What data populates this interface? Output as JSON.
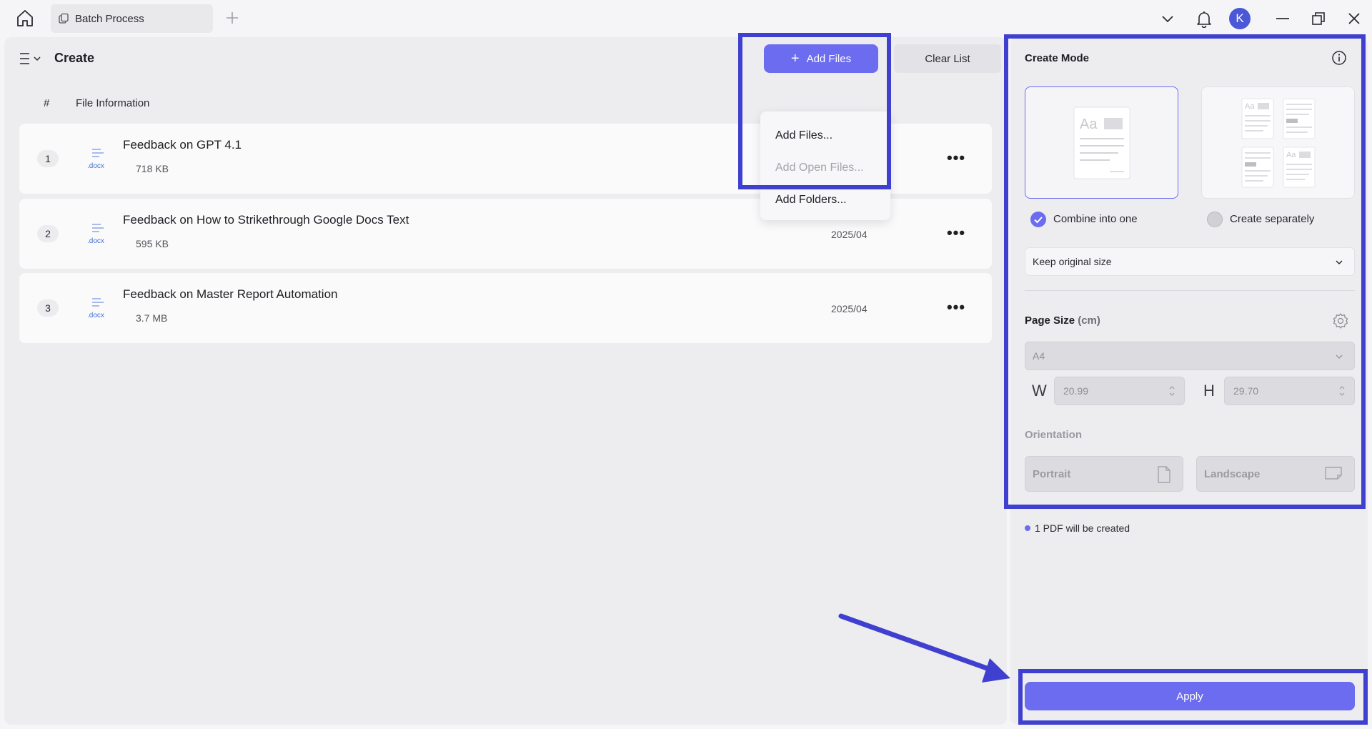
{
  "titlebar": {
    "tab_label": "Batch Process",
    "avatar_letter": "K"
  },
  "left": {
    "title": "Create",
    "add_files_label": "Add Files",
    "clear_list_label": "Clear List",
    "columns": {
      "number": "#",
      "file_info": "File Information"
    },
    "files": [
      {
        "num": "1",
        "name": "Feedback on GPT 4.1",
        "ext": ".docx",
        "size": "718 KB",
        "date": ""
      },
      {
        "num": "2",
        "name": "Feedback on How to Strikethrough Google Docs Text",
        "ext": ".docx",
        "size": "595 KB",
        "date": "2025/04"
      },
      {
        "num": "3",
        "name": "Feedback on Master Report Automation",
        "ext": ".docx",
        "size": "3.7 MB",
        "date": "2025/04"
      }
    ],
    "dropdown": {
      "items": [
        {
          "label": "Add Files...",
          "enabled": true
        },
        {
          "label": "Add Open Files...",
          "enabled": false
        },
        {
          "label": "Add Folders...",
          "enabled": true
        }
      ]
    }
  },
  "right": {
    "create_mode_title": "Create Mode",
    "combine_label": "Combine into one",
    "separate_label": "Create separately",
    "combine_selected": true,
    "size_option": "Keep original size",
    "page_size_title": "Page Size",
    "page_size_unit": "(cm)",
    "page_format": "A4",
    "width_label": "W",
    "width_value": "20.99",
    "height_label": "H",
    "height_value": "29.70",
    "orientation_title": "Orientation",
    "portrait_label": "Portrait",
    "landscape_label": "Landscape",
    "pdf_note": "1 PDF will be created",
    "apply_label": "Apply"
  },
  "colors": {
    "accent": "#6b6cf0",
    "annotation": "#3f40cf"
  }
}
